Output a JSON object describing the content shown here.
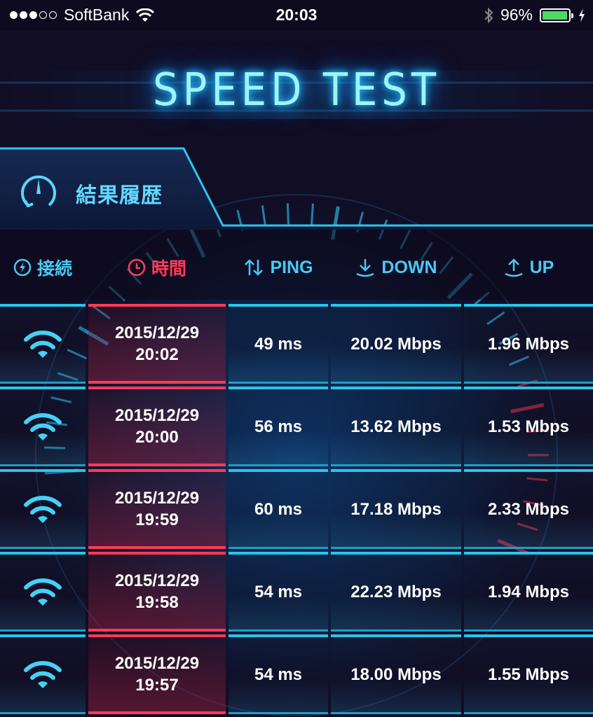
{
  "status_bar": {
    "carrier": "SoftBank",
    "time": "20:03",
    "battery": "96%",
    "battery_level": 0.96
  },
  "title": "SPEED TEST",
  "history_tab": {
    "label": "結果履歴"
  },
  "columns": {
    "connection": "接続",
    "time": "時間",
    "ping": "PING",
    "down": "DOWN",
    "up": "UP"
  },
  "rows": [
    {
      "connection": "wifi-icon",
      "date": "2015/12/29",
      "time": "20:02",
      "ping": "49 ms",
      "down": "20.02 Mbps",
      "up": "1.96 Mbps"
    },
    {
      "connection": "wifi-icon",
      "date": "2015/12/29",
      "time": "20:00",
      "ping": "56 ms",
      "down": "13.62 Mbps",
      "up": "1.53 Mbps"
    },
    {
      "connection": "wifi-icon",
      "date": "2015/12/29",
      "time": "19:59",
      "ping": "60 ms",
      "down": "17.18 Mbps",
      "up": "2.33 Mbps"
    },
    {
      "connection": "wifi-icon",
      "date": "2015/12/29",
      "time": "19:58",
      "ping": "54 ms",
      "down": "22.23 Mbps",
      "up": "1.94 Mbps"
    },
    {
      "connection": "wifi-icon",
      "date": "2015/12/29",
      "time": "19:57",
      "ping": "54 ms",
      "down": "18.00 Mbps",
      "up": "1.55 Mbps"
    }
  ],
  "colors": {
    "accent": "#27c6ea",
    "active": "#ff3b57",
    "background": "#0e0b1e",
    "battery": "#4cd964"
  }
}
